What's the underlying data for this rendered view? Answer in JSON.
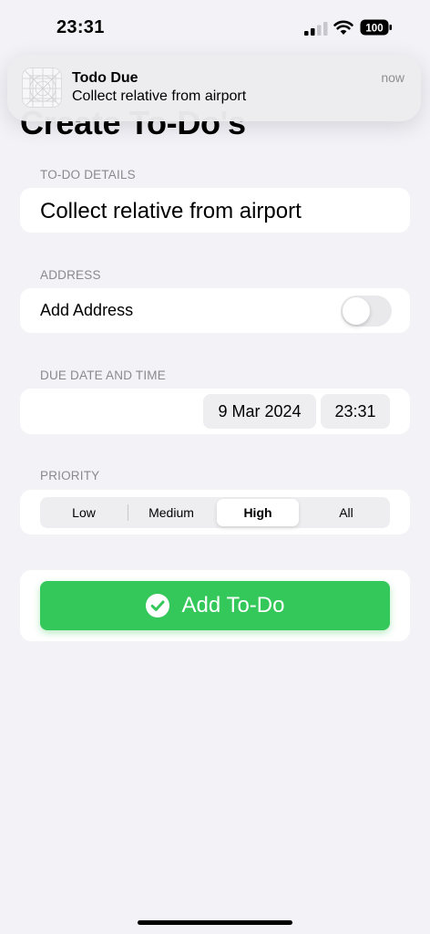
{
  "status_bar": {
    "time": "23:31",
    "battery": "100"
  },
  "page": {
    "title": "Create To-Do's"
  },
  "notification": {
    "app_name": "Todo Due",
    "message": "Collect relative from airport",
    "time": "now"
  },
  "details": {
    "header": "TO-DO DETAILS",
    "value": "Collect relative from airport"
  },
  "address": {
    "header": "ADDRESS",
    "label": "Add Address",
    "toggle_on": false
  },
  "due": {
    "header": "DUE DATE AND TIME",
    "date": "9 Mar 2024",
    "time": "23:31"
  },
  "priority": {
    "header": "PRIORITY",
    "options": [
      "Low",
      "Medium",
      "High",
      "All"
    ],
    "selected": "High"
  },
  "actions": {
    "add_label": "Add To-Do"
  },
  "colors": {
    "accent_green": "#34c759",
    "background": "#f2f2f7",
    "card": "#ffffff",
    "secondary_text": "#8a8a8e"
  },
  "icons": [
    "signal-icon",
    "wifi-icon",
    "battery-icon",
    "app-icon",
    "checkmark-circle-icon"
  ]
}
